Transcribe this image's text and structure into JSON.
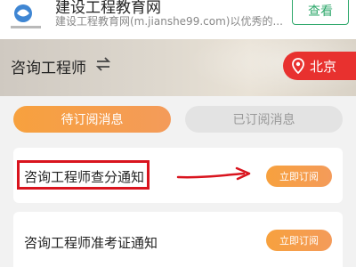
{
  "banner": {
    "site_name": "建设工程教育网",
    "description": "建设工程教育网(m.jianshe99.com)以优秀的...",
    "view_button": "查看",
    "logo_icon": "jianshe99-logo-icon"
  },
  "header": {
    "title": "咨询工程师",
    "switch_icon": "swap-icon",
    "city": "北京",
    "city_icon": "location-pin-icon"
  },
  "tabs": [
    {
      "label": "待订阅消息",
      "active": true
    },
    {
      "label": "已订阅消息",
      "active": false
    }
  ],
  "notifications": [
    {
      "title": "咨询工程师查分通知",
      "button": "立即订阅"
    },
    {
      "title": "咨询工程师准考证通知",
      "button": "立即订阅"
    }
  ],
  "colors": {
    "accent_orange": "#f7a13e",
    "city_red": "#e8312f",
    "annotation_red": "#d9141e",
    "view_green": "#2ea86b"
  }
}
